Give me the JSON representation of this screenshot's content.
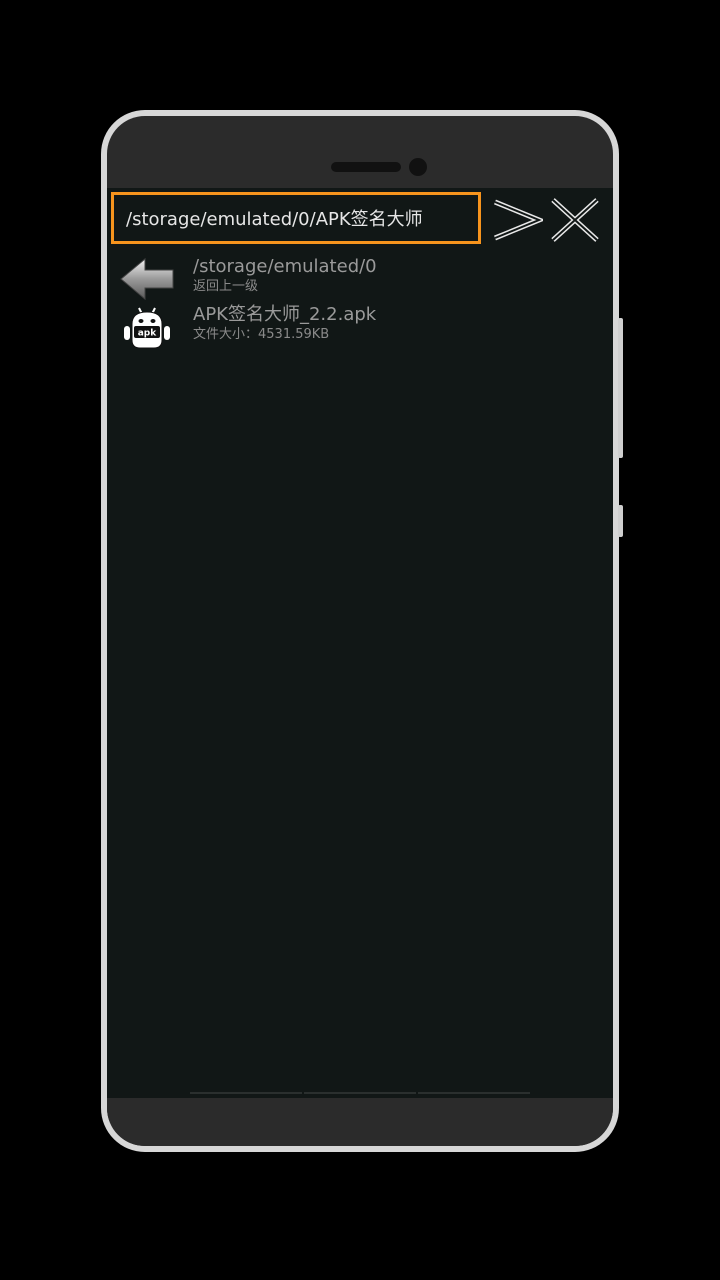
{
  "path_bar": {
    "current_path": "/storage/emulated/0/APK签名大师"
  },
  "nav": {
    "forward_icon": "chevron-right-icon",
    "close_icon": "close-icon"
  },
  "items": [
    {
      "icon": "back-arrow-icon",
      "title": "/storage/emulated/0",
      "subtitle": "返回上一级"
    },
    {
      "icon": "apk-android-icon",
      "title": "APK签名大师_2.2.apk",
      "subtitle": "文件大小：4531.59KB",
      "icon_label": "apk"
    }
  ],
  "colors": {
    "accent": "#f7941d",
    "screen_bg": "#111716"
  }
}
